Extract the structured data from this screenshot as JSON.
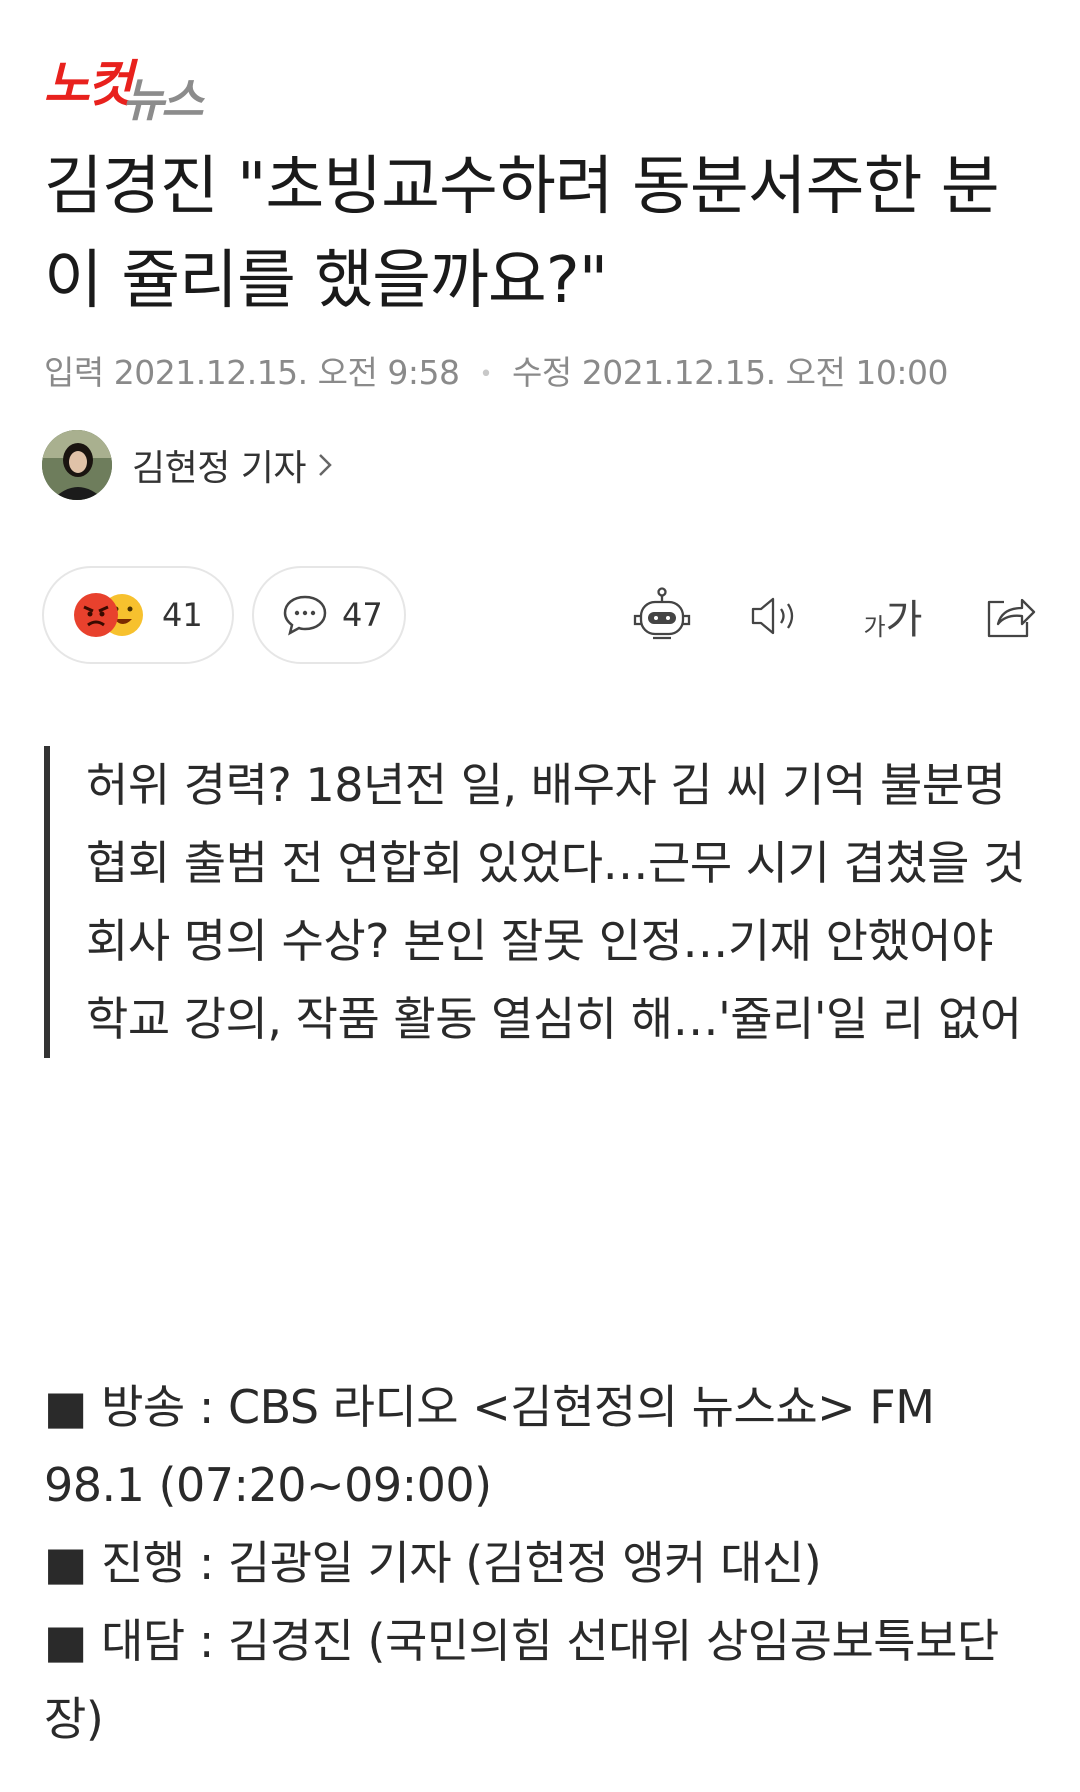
{
  "logo": {
    "part1": "노컷",
    "part2": "뉴스"
  },
  "article": {
    "title": "김경진 \"초빙교수하려 동분서주한 분이 쥴리를 했을까요?\"",
    "input_label": "입력",
    "input_date": "2021.12.15. 오전 9:58",
    "edit_label": "수정",
    "edit_date": "2021.12.15. 오전 10:00",
    "author": "김현정 기자"
  },
  "reactions": {
    "count": "41",
    "comments": "47"
  },
  "toolbar": {
    "font_small": "가",
    "font_large": "가"
  },
  "summary": [
    "허위 경력? 18년전 일, 배우자 김 씨 기억 불분명",
    "협회 출범 전 연합회 있었다…근무 시기 겹쳤을 것",
    "회사 명의 수상? 본인 잘못 인정…기재 안했어야",
    "학교 강의, 작품 활동 열심히 해…'쥴리'일 리 없어"
  ],
  "info": [
    "■ 방송 : CBS 라디오 <김현정의 뉴스쇼> FM 98.1 (07:20~09:00)",
    "■ 진행 : 김광일 기자 (김현정 앵커 대신)",
    "■ 대담 : 김경진 (국민의힘 선대위 상임공보특보단장)"
  ],
  "colors": {
    "logo_red": "#e8211d",
    "logo_gray": "#888888",
    "angry": "#e8412d",
    "smile": "#f7c12e"
  }
}
